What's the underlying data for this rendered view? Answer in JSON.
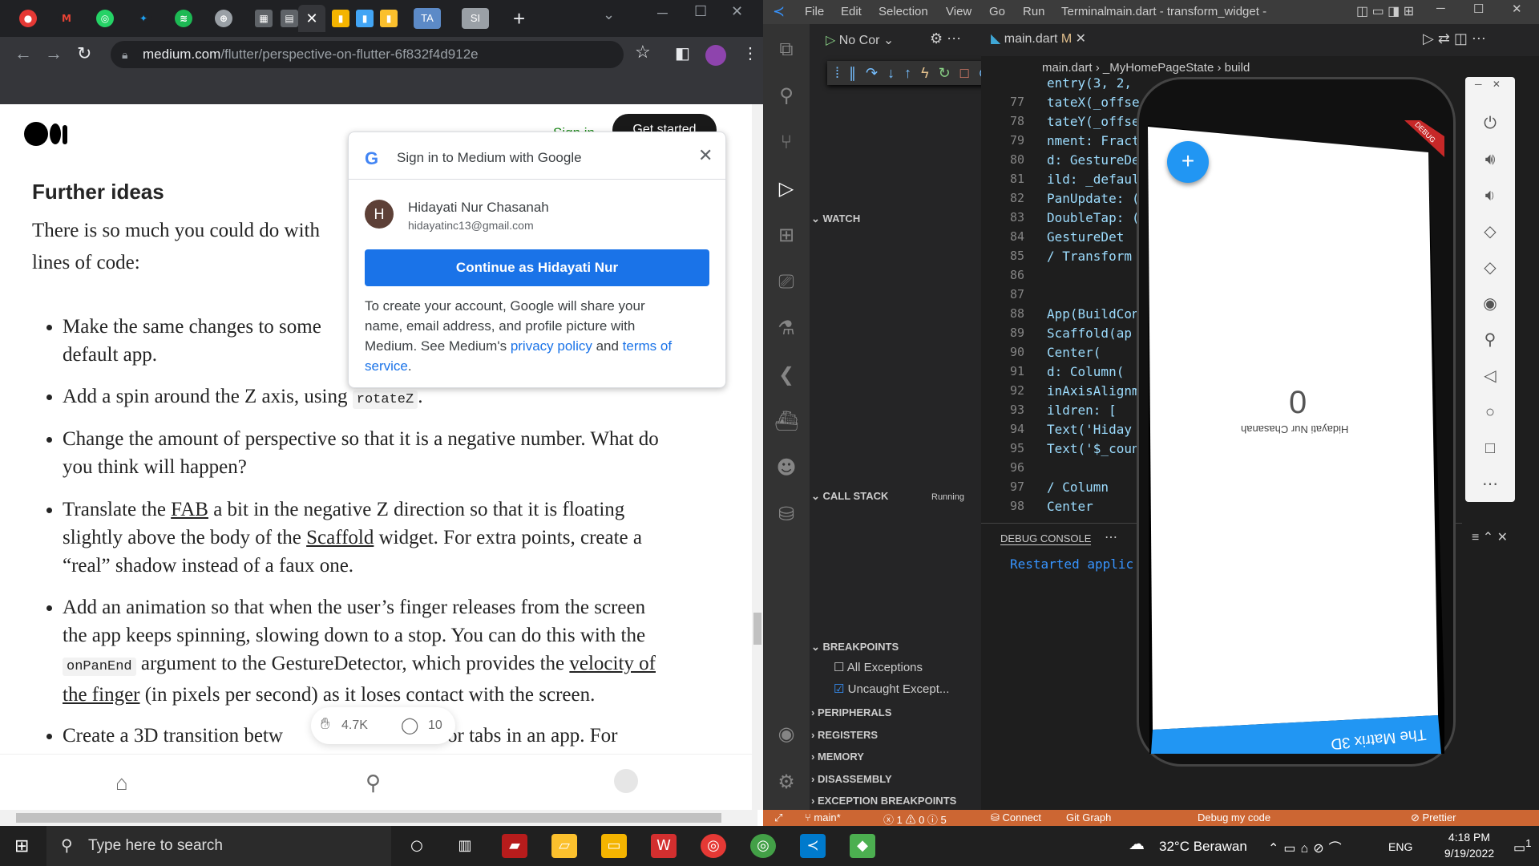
{
  "browser": {
    "url_domain": "medium.com",
    "url_path": "/flutter/perspective-on-flutter-6f832f4d912e",
    "tab_labels": [
      "TA",
      "SI"
    ]
  },
  "medium": {
    "signin_link": "Sign in",
    "get_started": "Get started",
    "heading": "Further ideas",
    "intro_line1": "There is so much you could do with",
    "intro_line2": "lines of code:",
    "bullets": [
      {
        "a": "Make the same changes to some",
        "b": "default app."
      },
      {
        "a": "Add a spin around the Z axis, using ",
        "code": "rotateZ",
        "c": "."
      },
      {
        "a": "Change the amount of perspective so that it is a negative number. What do",
        "b": "you think will happen?"
      },
      {
        "a": "Translate the ",
        "fab": "FAB",
        "a2": " a bit in the negative Z direction so that it is floating",
        "b": "slightly above the body of the ",
        "scaffold": "Scaffold",
        "b2": " widget. For extra points, create a",
        "c": "“real” shadow instead of a faux one."
      },
      {
        "a": "Add an animation so that when the user’s finger releases from the screen",
        "b": "the app keeps spinning, slowing down to a stop. You can do this with the",
        "code": "onPanEnd",
        "c": " argument to the GestureDetector, which provides the ",
        "link1": "velocity of",
        "link2": "the finger",
        "d": " (in pixels per second) as it loses contact with the screen."
      },
      {
        "a": "Create a 3D transition betw",
        "b": "or tabs in an app. For"
      }
    ],
    "claps": "4.7K",
    "responses": "10"
  },
  "google_popup": {
    "title": "Sign in to Medium with Google",
    "avatar_letter": "H",
    "name": "Hidayati Nur Chasanah",
    "email": "hidayatinc13@gmail.com",
    "continue_label": "Continue as Hidayati Nur",
    "desc_1": "To create your account, Google will share your",
    "desc_2": "name, email address, and profile picture with",
    "desc_3": "Medium. See Medium's ",
    "privacy": "privacy policy",
    "and": " and ",
    "terms": "terms of",
    "service": "service",
    "period": "."
  },
  "vscode": {
    "menu": [
      "File",
      "Edit",
      "Selection",
      "View",
      "Go",
      "Run",
      "Terminal"
    ],
    "title": "main.dart - transform_widget - Visua...",
    "debug_config": "No Cor",
    "tab_file": "main.dart",
    "tab_flag": "M",
    "breadcrumb_file": "main.dart",
    "breadcrumb_class": "_MyHomePageState",
    "breadcrumb_method": "build",
    "watch": "WATCH",
    "call_stack": "CALL STACK",
    "call_stack_status": "Running",
    "breakpoints": "BREAKPOINTS",
    "bp_all": "All Exceptions",
    "bp_uncaught": "Uncaught Except...",
    "peripherals": "PERIPHERALS",
    "registers": "REGISTERS",
    "memory": "MEMORY",
    "disassembly": "DISASSEMBLY",
    "exception_breakpoints": "EXCEPTION BREAKPOINTS",
    "debug_console": "DEBUG CONSOLE",
    "console_text": "Restarted applic",
    "line_numbers": [
      "77",
      "78",
      "79",
      "80",
      "81",
      "82",
      "83",
      "84",
      "85",
      "86",
      "87",
      "88",
      "89",
      "90",
      "91",
      "92",
      "93",
      "94",
      "95",
      "96",
      "97",
      "98"
    ],
    "code_top": "entry(3, 2,",
    "code_lines": [
      "tateX(_offse",
      "tateY(_offse",
      "nment: Fract",
      "d: GestureDe",
      "ild: _defaul",
      "PanUpdate: (",
      "DoubleTap: (",
      "GestureDet",
      "/ Transform",
      "",
      "",
      "App(BuildCon",
      " Scaffold(ap",
      "Center(",
      "d: Column(",
      "inAxisAlignm",
      "ildren: [",
      "Text('Hiday",
      "Text('$_coun",
      "",
      " / Column",
      " Center"
    ],
    "status": {
      "branch": "main*",
      "problems": "ⓧ 1 ⚠ 0 ⓘ 5",
      "connect": "Connect",
      "git_graph": "Git Graph",
      "debug": "Debug my code",
      "prettier": "Prettier"
    }
  },
  "emulator": {
    "counter": "0",
    "name_text": "Hidayati Nur Chasanah",
    "appbar_title": "The Matrix 3D",
    "debug_banner": "DEBUG",
    "fab": "+"
  },
  "taskbar": {
    "search_placeholder": "Type here to search",
    "weather": "32°C  Berawan",
    "lang": "ENG",
    "time": "4:18 PM",
    "date": "9/19/2022",
    "notif": "1"
  },
  "colors": {
    "google_blue": "#1a73e8",
    "vscode_status": "#cc6633",
    "flutter_blue": "#2196f3"
  }
}
